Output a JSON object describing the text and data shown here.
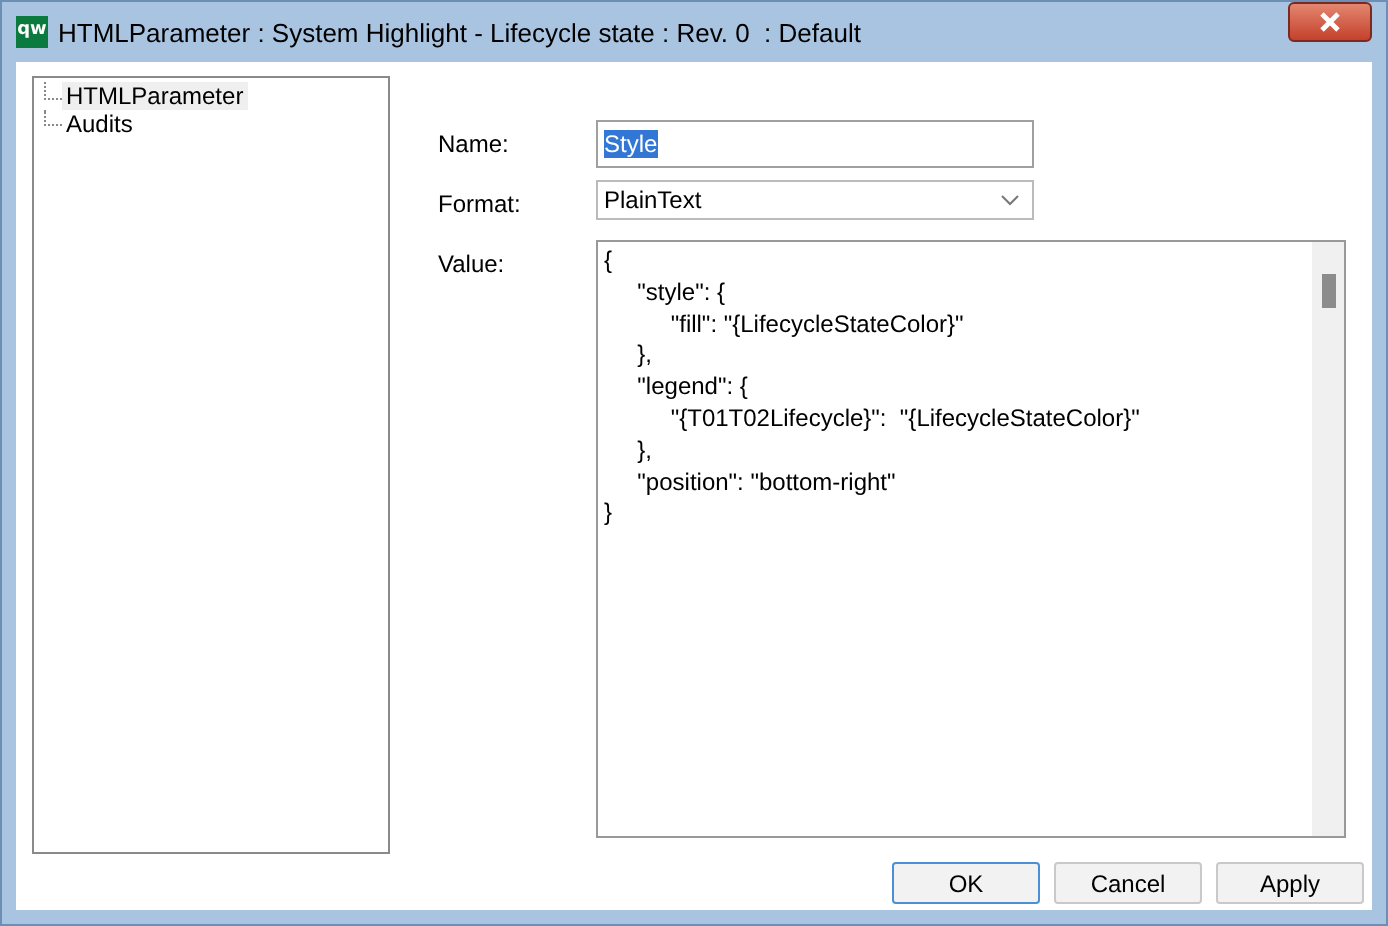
{
  "window": {
    "title": "HTMLParameter : System Highlight - Lifecycle state : Rev. 0  : Default",
    "app_icon": "qw"
  },
  "tree": {
    "items": [
      {
        "label": "HTMLParameter",
        "selected": true
      },
      {
        "label": "Audits",
        "selected": false
      }
    ]
  },
  "form": {
    "name": {
      "label": "Name:",
      "value": "Style",
      "text_selected": true
    },
    "format": {
      "label": "Format:",
      "value": "PlainText"
    },
    "value": {
      "label": "Value:",
      "text": "{\n\t\"style\": {\n\t\t\"fill\": \"{LifecycleStateColor}\"\n\t},\n\t\"legend\": {\n\t\t\"{T01T02Lifecycle}\":  \"{LifecycleStateColor}\"\n\t},\n\t\"position\": \"bottom-right\"\n}"
    }
  },
  "buttons": [
    {
      "label": "OK",
      "default": true
    },
    {
      "label": "Cancel",
      "default": false
    },
    {
      "label": "Apply",
      "default": false
    }
  ]
}
